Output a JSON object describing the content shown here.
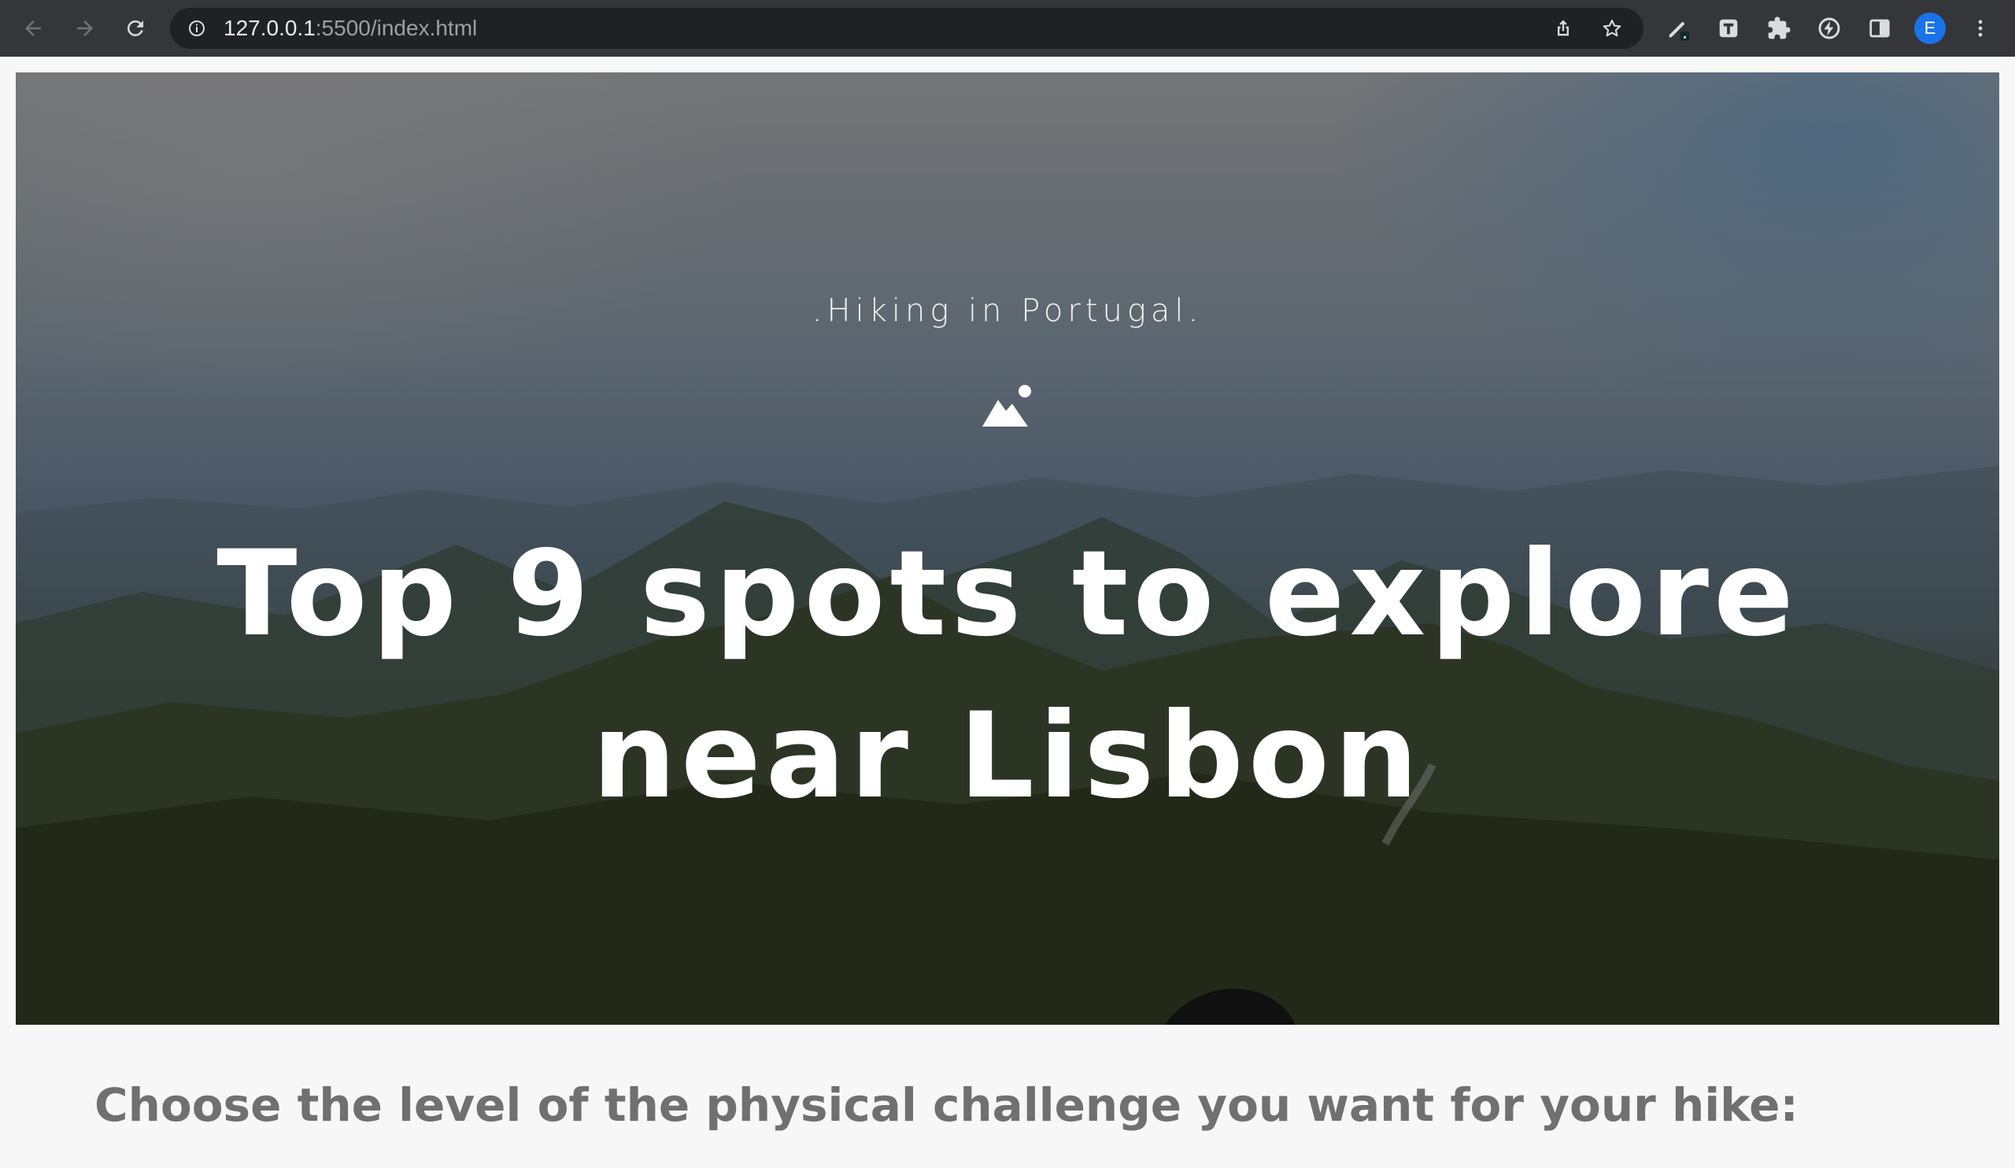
{
  "browser": {
    "url_host": "127.0.0.1",
    "url_rest": ":5500/index.html",
    "profile_initial": "E",
    "icons": [
      "back-arrow-icon",
      "forward-arrow-icon",
      "reload-icon",
      "site-info-icon",
      "share-icon",
      "bookmark-star-icon",
      "pen-extension-icon",
      "text-extension-icon",
      "extensions-puzzle-icon",
      "speed-extension-icon",
      "side-panel-icon",
      "more-menu-icon"
    ]
  },
  "hero": {
    "kicker": ".Hiking in Portugal.",
    "icon": "mountain-icon",
    "headline": "Top 9 spots to explore near Lisbon"
  },
  "section": {
    "subhead": "Choose the level of the physical challenge you want for your hike:"
  },
  "colors": {
    "toolbar": "#35363a",
    "omnibox": "#202124",
    "avatar": "#1a73e8",
    "page_bg": "#f7f7f7",
    "subhead_text": "#707070"
  }
}
